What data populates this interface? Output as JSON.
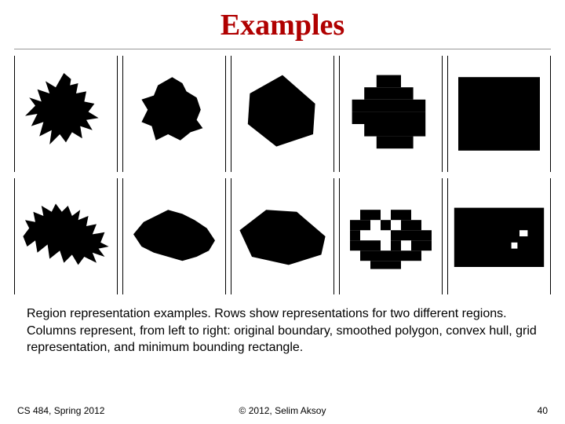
{
  "title": "Examples",
  "caption": "Region representation examples. Rows show representations for two different regions. Columns represent, from left to right: original boundary, smoothed polygon, convex hull, grid representation, and minimum bounding rectangle.",
  "footer": {
    "left": "CS 484, Spring 2012",
    "center": "© 2012, Selim Aksoy",
    "right": "40"
  },
  "grid": {
    "rows": 2,
    "columns": 5,
    "column_labels": [
      "original boundary",
      "smoothed polygon",
      "convex hull",
      "grid representation",
      "minimum bounding rectangle"
    ]
  }
}
